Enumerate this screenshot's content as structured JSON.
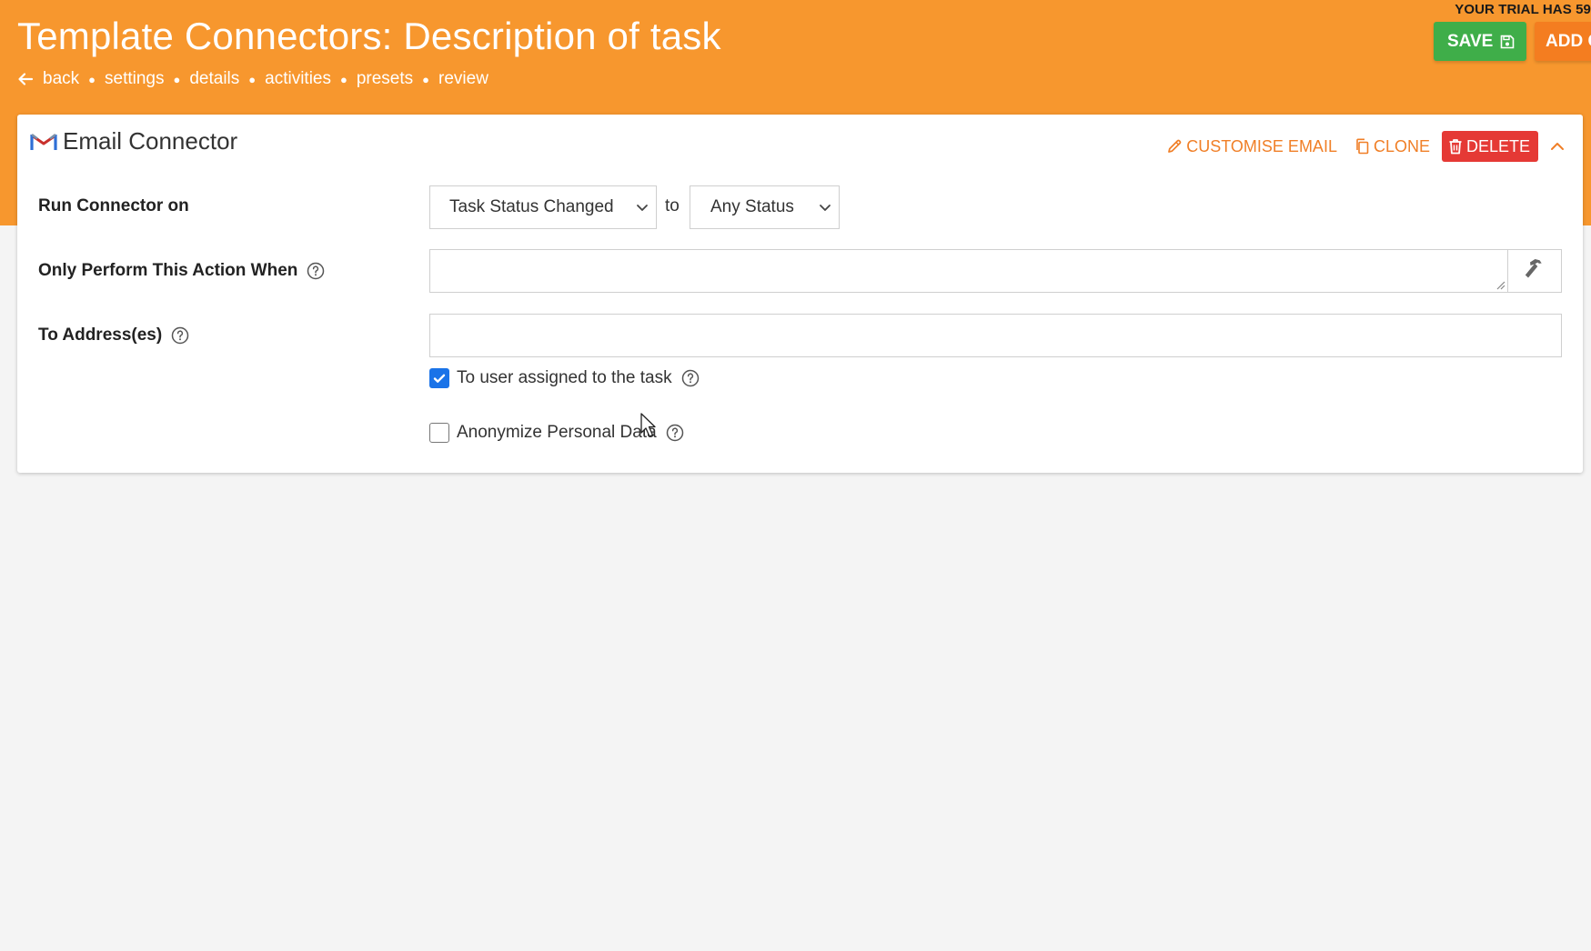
{
  "header": {
    "trial_text": "YOUR TRIAL HAS 59",
    "title": "Template Connectors: Description of task",
    "nav": {
      "back": "back",
      "links": [
        "settings",
        "details",
        "activities",
        "presets",
        "review"
      ]
    },
    "save_label": "SAVE",
    "add_label": "ADD C"
  },
  "card": {
    "title": "Email Connector",
    "actions": {
      "customise": "CUSTOMISE EMAIL",
      "clone": "CLONE",
      "delete": "DELETE"
    },
    "run_on": {
      "label": "Run Connector on",
      "trigger_value": "Task Status Changed",
      "connector_word": "to",
      "status_value": "Any Status"
    },
    "condition": {
      "label": "Only Perform This Action When",
      "value": ""
    },
    "to_address": {
      "label": "To Address(es)",
      "value": ""
    },
    "assigned_user": {
      "label": "To user assigned to the task",
      "checked": true
    },
    "anonymize": {
      "label": "Anonymize Personal Data",
      "checked": false
    }
  },
  "colors": {
    "header_bg": "#f7972e",
    "save": "#3fae49",
    "delete": "#e53935",
    "action_link": "#f07f27",
    "checkbox_on": "#1a73e8"
  },
  "icons": {
    "back": "arrow-left-icon",
    "save": "floppy-disk-icon",
    "email": "gmail-icon",
    "customise": "pencil-icon",
    "clone": "copy-icon",
    "delete": "trash-icon",
    "collapse": "chevron-up-icon",
    "help": "question-circle-icon",
    "tool": "hammer-icon"
  }
}
